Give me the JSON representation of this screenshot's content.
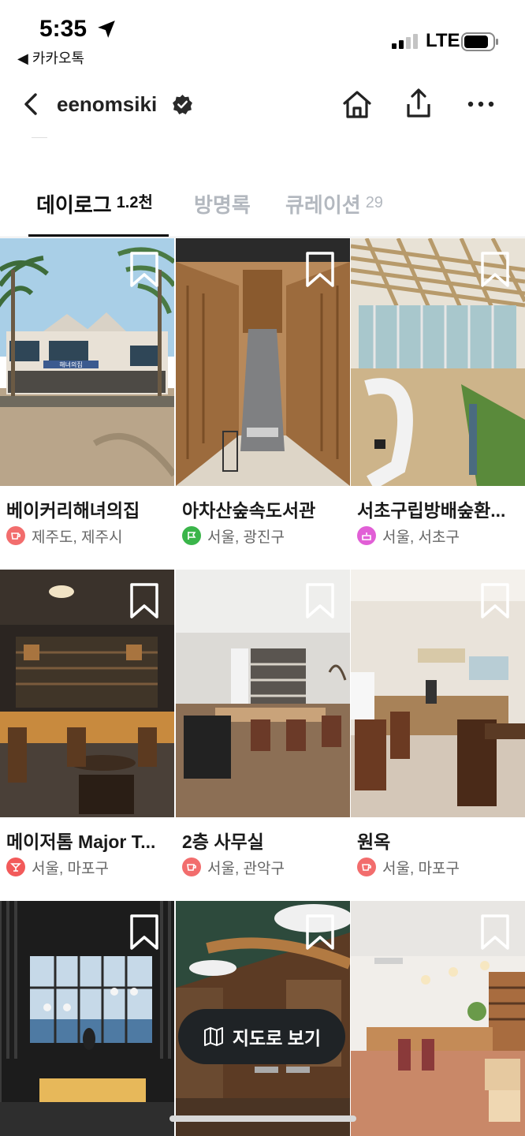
{
  "status_bar": {
    "time": "5:35",
    "back_app": "◀ 카카오톡",
    "network": "LTE"
  },
  "header": {
    "profile_name": "eenomsiki"
  },
  "tabs": [
    {
      "label": "데이로그",
      "count": "1.2천",
      "active": true
    },
    {
      "label": "방명록",
      "count": "",
      "active": false
    },
    {
      "label": "큐레이션",
      "count": "29",
      "active": false
    }
  ],
  "places": [
    {
      "title": "베이커리해녀의집",
      "location": "제주도, 제주시",
      "category_icon": "coffee-icon",
      "category_color": "#f26d6d",
      "sign_text": "해녀의집"
    },
    {
      "title": "아차산숲속도서관",
      "location": "서울, 광진구",
      "category_icon": "flag-icon",
      "category_color": "#3ab54a"
    },
    {
      "title": "서초구립방배숲환...",
      "location": "서울, 서초구",
      "category_icon": "cake-icon",
      "category_color": "#e15fd6"
    },
    {
      "title": "메이저톰 Major T...",
      "location": "서울, 마포구",
      "category_icon": "cocktail-icon",
      "category_color": "#f25a5a"
    },
    {
      "title": "2층 사무실",
      "location": "서울, 관악구",
      "category_icon": "coffee-icon",
      "category_color": "#f26d6d"
    },
    {
      "title": "원옥",
      "location": "서울, 마포구",
      "category_icon": "coffee-icon",
      "category_color": "#f26d6d"
    },
    {
      "title": "",
      "location": "",
      "category_icon": "",
      "category_color": ""
    },
    {
      "title": "",
      "location": "",
      "category_icon": "",
      "category_color": ""
    },
    {
      "title": "",
      "location": "",
      "category_icon": "",
      "category_color": ""
    }
  ],
  "map_button": {
    "label": "지도로 보기",
    "icon": "map-icon"
  },
  "colors": {
    "tab_active": "#111111",
    "tab_inactive": "#b3b8bf",
    "map_button_bg": "#1f2326"
  }
}
